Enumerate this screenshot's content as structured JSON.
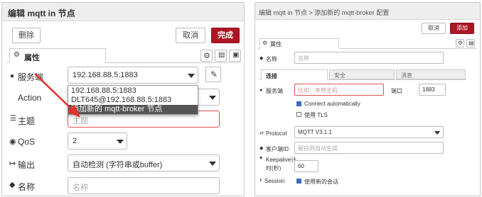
{
  "left": {
    "title": "编辑 mqtt in 节点",
    "delete_label": "删除",
    "cancel_label": "取消",
    "done_label": "完成",
    "tab_label": "属性",
    "server_label": "服务端",
    "server_value": "192.168.88.5:1883",
    "action_label": "Action",
    "topic_label": "主题",
    "topic_placeholder": "主题",
    "qos_label": "QoS",
    "qos_value": "2",
    "output_label": "输出",
    "output_value": "自动检测 (字符串或buffer)",
    "name_label": "名称",
    "name_placeholder": "名称",
    "dropdown": [
      "192.168.88.5:1883",
      "DLT645@192.168.88.5:1883",
      "添加新的 mqtt-broker 节点"
    ]
  },
  "right": {
    "title": "编辑 mqtt in 节点 > 添加新的 mqtt-broker 配置",
    "cancel_label": "取消",
    "add_label": "添加",
    "tab_label": "属性",
    "name_label": "名称",
    "name_placeholder": "名称",
    "sub_tabs": [
      "连接",
      "安全",
      "消息"
    ],
    "server_label": "服务端",
    "server_placeholder": "比如：本地主机",
    "port_label": "端口",
    "port_value": "1883",
    "connect_auto": "Connect automatically",
    "use_tls": "使用 TLS",
    "protocol_label": "Protocol",
    "protocol_value": "MQTT V3.1.1",
    "client_id_label": "客户端ID",
    "client_id_placeholder": "留白则自动生成",
    "keepalive_label": "Keepalive计",
    "keepalive_label2": "时(秒)",
    "keepalive_value": "60",
    "session_label": "Session",
    "session_value": "使用新的会话"
  },
  "colors": {
    "accent": "#ad1625",
    "arrow": "#e8302a",
    "invalid": "#d9534f"
  }
}
